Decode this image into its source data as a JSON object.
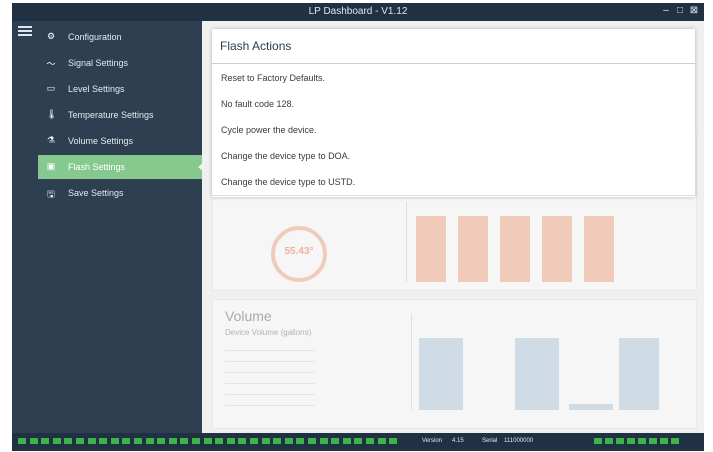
{
  "window": {
    "title": "LP Dashboard - V1.12",
    "min_glyph": "–",
    "max_glyph": "□",
    "close_glyph": "⊠"
  },
  "sidebar": {
    "items": [
      {
        "label": "Configuration",
        "icon": "gear-icon",
        "glyph": "⚙"
      },
      {
        "label": "Signal Settings",
        "icon": "signal-icon",
        "glyph": "〜"
      },
      {
        "label": "Level Settings",
        "icon": "level-icon",
        "glyph": "▭"
      },
      {
        "label": "Temperature Settings",
        "icon": "thermometer-icon",
        "glyph": "🌡"
      },
      {
        "label": "Volume Settings",
        "icon": "volume-icon",
        "glyph": "⚗"
      },
      {
        "label": "Flash Settings",
        "icon": "flash-icon",
        "glyph": "▣"
      },
      {
        "label": "Save Settings",
        "icon": "save-icon",
        "glyph": "🖫"
      }
    ],
    "active_index": 5
  },
  "flash_actions": {
    "title": "Flash Actions",
    "items": [
      "Reset to Factory Defaults.",
      "No fault code 128.",
      "Cycle power the device.",
      "Change the device type to DOA.",
      "Change the device type to USTD."
    ]
  },
  "temperature_card": {
    "gauge_value": "55.43°"
  },
  "volume_card": {
    "title": "Volume",
    "subtitle": "Device Volume (gallons)"
  },
  "status": {
    "version_label": "Version",
    "version_value": "4.15",
    "serial_label": "Serial",
    "serial_value": "111000000"
  },
  "colors": {
    "sidebar_bg": "#2d3f51",
    "active_item": "#86c98e",
    "status_chip": "#3db34a",
    "temp_bars": "#f4a07a",
    "volume_bars": "#a8c4d9"
  }
}
